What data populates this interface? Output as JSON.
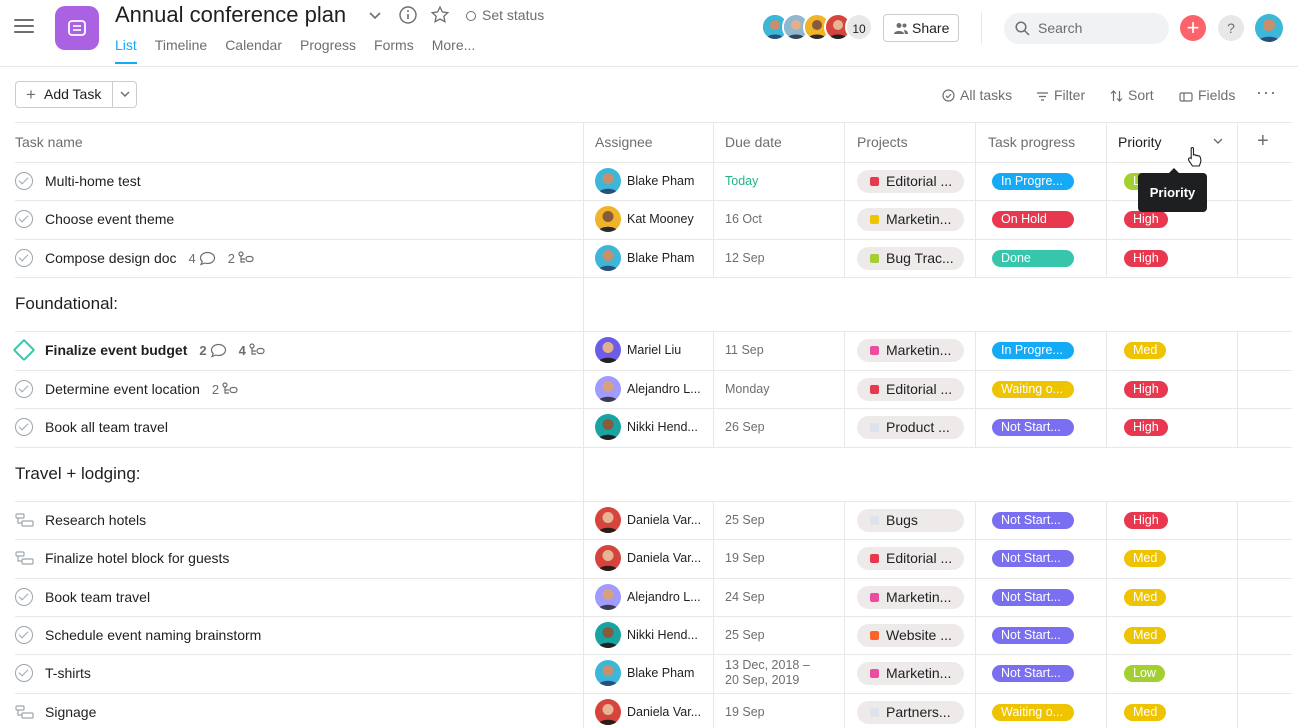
{
  "header": {
    "project_title": "Annual conference plan",
    "set_status": "Set status",
    "tabs": [
      "List",
      "Timeline",
      "Calendar",
      "Progress",
      "Forms",
      "More..."
    ],
    "member_count": "10",
    "share_label": "Share",
    "search_placeholder": "Search",
    "add_symbol": "+",
    "help_symbol": "?"
  },
  "toolbar": {
    "add_task_label": "Add Task",
    "all_tasks_label": "All tasks",
    "filter_label": "Filter",
    "sort_label": "Sort",
    "fields_label": "Fields",
    "more_label": "···"
  },
  "columns": {
    "task_name": "Task name",
    "assignee": "Assignee",
    "due_date": "Due date",
    "projects": "Projects",
    "task_progress": "Task progress",
    "priority": "Priority",
    "add_column": "+"
  },
  "tooltip": "Priority",
  "colors": {
    "accent": "#14aaf5",
    "project_icon": "#aa62e3",
    "status_in_progress": "#14aaf5",
    "status_on_hold": "#e8384f",
    "status_done": "#37c5ab",
    "status_waiting": "#eec300",
    "status_not_started": "#7a6ff0",
    "priority_low": "#a4cf30",
    "priority_high": "#e8384f",
    "priority_med": "#eec300"
  },
  "rows": [
    {
      "name": "Multi-home test",
      "icon": "check-icon",
      "assignee": "Blake Pham",
      "due": "Today",
      "project": "Editorial ...",
      "project_color": "#e8384f",
      "progress": "In Progre...",
      "progress_color": "#14aaf5",
      "priority": "Low",
      "priority_color": "#a4cf30"
    },
    {
      "name": "Choose event theme",
      "icon": "check-icon",
      "assignee": "Kat Mooney",
      "due": "16 Oct",
      "project": "Marketin...",
      "project_color": "#eec300",
      "progress": "On Hold",
      "progress_color": "#e8384f",
      "priority": "High",
      "priority_color": "#e8384f"
    },
    {
      "name": "Compose design doc",
      "icon": "check-icon",
      "comments": "4",
      "subtasks": "2",
      "assignee": "Blake Pham",
      "due": "12 Sep",
      "project": "Bug Trac...",
      "project_color": "#a4cf30",
      "progress": "Done",
      "progress_color": "#37c5ab",
      "priority": "High",
      "priority_color": "#e8384f"
    }
  ],
  "sections": [
    {
      "title": "Foundational:",
      "rows": [
        {
          "name": "Finalize event budget",
          "icon": "milestone-icon",
          "bold": true,
          "comments": "2",
          "subtasks": "4",
          "assignee": "Mariel Liu",
          "due": "11 Sep",
          "project": "Marketin...",
          "project_color": "#ea4e9d",
          "progress": "In Progre...",
          "progress_color": "#14aaf5",
          "priority": "Med",
          "priority_color": "#eec300"
        },
        {
          "name": "Determine event location",
          "icon": "check-icon",
          "subtasks": "2",
          "assignee": "Alejandro L...",
          "due": "Monday",
          "project": "Editorial ...",
          "project_color": "#e8384f",
          "progress": "Waiting o...",
          "progress_color": "#eec300",
          "priority": "High",
          "priority_color": "#e8384f"
        },
        {
          "name": "Book all team travel",
          "icon": "check-icon",
          "assignee": "Nikki Hend...",
          "due": "26 Sep",
          "project": "Product ...",
          "project_color": "#dde2ec",
          "progress": "Not Start...",
          "progress_color": "#7a6ff0",
          "priority": "High",
          "priority_color": "#e8384f"
        }
      ]
    },
    {
      "title": "Travel + lodging:",
      "rows": [
        {
          "name": "Research hotels",
          "icon": "subtask-icon",
          "assignee": "Daniela Var...",
          "due": "25 Sep",
          "project": "Bugs",
          "project_color": "#dde2ec",
          "progress": "Not Start...",
          "progress_color": "#7a6ff0",
          "priority": "High",
          "priority_color": "#e8384f"
        },
        {
          "name": "Finalize hotel block for guests",
          "icon": "subtask-icon",
          "assignee": "Daniela Var...",
          "due": "19 Sep",
          "project": "Editorial ...",
          "project_color": "#e8384f",
          "progress": "Not Start...",
          "progress_color": "#7a6ff0",
          "priority": "Med",
          "priority_color": "#eec300"
        },
        {
          "name": "Book team travel",
          "icon": "check-icon",
          "assignee": "Alejandro L...",
          "due": "24 Sep",
          "project": "Marketin...",
          "project_color": "#ea4e9d",
          "progress": "Not Start...",
          "progress_color": "#7a6ff0",
          "priority": "Med",
          "priority_color": "#eec300"
        },
        {
          "name": "Schedule event naming brainstorm",
          "icon": "check-icon",
          "assignee": "Nikki Hend...",
          "due": "25 Sep",
          "project": "Website ...",
          "project_color": "#fd612c",
          "progress": "Not Start...",
          "progress_color": "#7a6ff0",
          "priority": "Med",
          "priority_color": "#eec300"
        },
        {
          "name": "T-shirts",
          "icon": "check-icon",
          "assignee": "Blake Pham",
          "due": "13 Dec, 2018 –",
          "due2": "20 Sep, 2019",
          "project": "Marketin...",
          "project_color": "#ea4e9d",
          "progress": "Not Start...",
          "progress_color": "#7a6ff0",
          "priority": "Low",
          "priority_color": "#a4cf30"
        },
        {
          "name": "Signage",
          "icon": "subtask-icon",
          "assignee": "Daniela Var...",
          "due": "19 Sep",
          "project": "Partners...",
          "project_color": "#dde2ec",
          "progress": "Waiting o...",
          "progress_color": "#eec300",
          "priority": "Med",
          "priority_color": "#eec300"
        }
      ]
    }
  ]
}
